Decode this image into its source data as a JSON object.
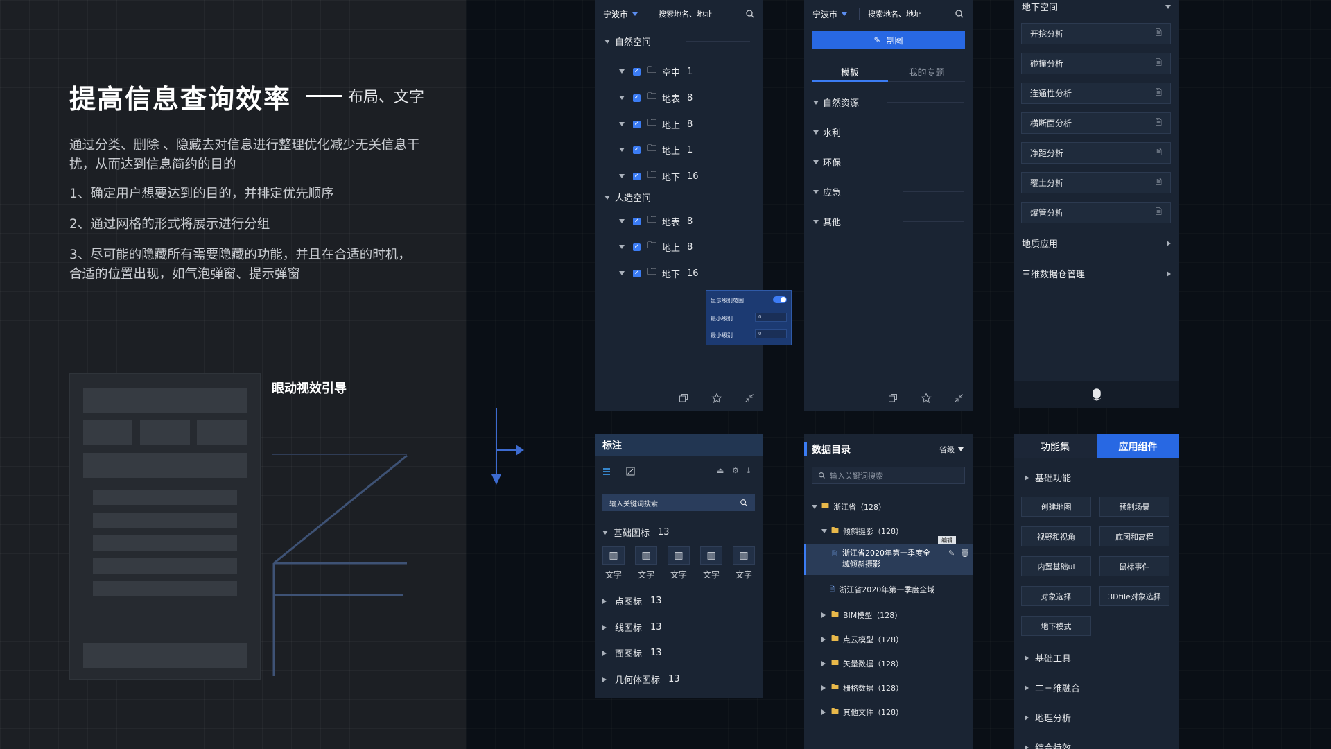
{
  "intro": {
    "title": "提高信息查询效率",
    "subtitle": "布局、文字",
    "p1": "通过分类、删除 、隐藏去对信息进行整理优化减少无关信息干扰，从而达到信息简约的目的",
    "p2": "1、确定用户想要达到的目的，并排定优先顺序",
    "p3": "2、通过网格的形式将展示进行分组",
    "p4": "3、尽可能的隐藏所有需要隐藏的功能，并且在合适的时机，合适的位置出现，如气泡弹窗、提示弹窗",
    "eye_label": "眼动视效引导"
  },
  "panel1": {
    "city": "宁波市",
    "search_placeholder": "搜索地名、地址",
    "group1": "自然空间",
    "group2": "人造空间",
    "items1": [
      {
        "label": "空中",
        "count": "1"
      },
      {
        "label": "地表",
        "count": "8"
      },
      {
        "label": "地上",
        "count": "8"
      },
      {
        "label": "地上",
        "count": "1"
      },
      {
        "label": "地下",
        "count": "16"
      }
    ],
    "items2": [
      {
        "label": "地表",
        "count": "8"
      },
      {
        "label": "地上",
        "count": "8"
      },
      {
        "label": "地下",
        "count": "16"
      }
    ],
    "popup": {
      "show_label": "显示级别范围",
      "min_label": "最小级别",
      "min_value": "0",
      "max_label": "最小级别",
      "max_value": "0"
    }
  },
  "panel2": {
    "city": "宁波市",
    "search_placeholder": "搜索地名、地址",
    "draw_button": "制图",
    "tab_template": "模板",
    "tab_mine": "我的专题",
    "categories": [
      "自然资源",
      "水利",
      "环保",
      "应急",
      "其他"
    ]
  },
  "panel3": {
    "header": "地下空间",
    "items": [
      "开挖分析",
      "碰撞分析",
      "连通性分析",
      "横断面分析",
      "净距分析",
      "覆土分析",
      "爆管分析"
    ],
    "sections": [
      "地质应用",
      "三维数据仓管理"
    ]
  },
  "panel4": {
    "title": "标注",
    "search_placeholder": "输入关键词搜索",
    "basic_group": "基础图标",
    "basic_count": "13",
    "icon_text": "文字",
    "groups": [
      {
        "label": "点图标",
        "count": "13"
      },
      {
        "label": "线图标",
        "count": "13"
      },
      {
        "label": "面图标",
        "count": "13"
      },
      {
        "label": "几何体图标",
        "count": "13"
      }
    ]
  },
  "panel5": {
    "title": "数据目录",
    "level": "省级",
    "search_placeholder": "输入关键词搜索",
    "root": "浙江省（128）",
    "sub": "倾斜摄影（128）",
    "selected_file": "浙江省2020年第一季度全域倾斜摄影",
    "edit_tip": "编辑",
    "file2": "浙江省2020年第一季度全域",
    "folders": [
      "BIM模型（128）",
      "点云模型（128）",
      "矢量数据（128）",
      "栅格数据（128）",
      "其他文件（128）"
    ]
  },
  "panel6": {
    "tab_func": "功能集",
    "tab_comp": "应用组件",
    "section1": "基础功能",
    "buttons": [
      "创建地图",
      "预制场景",
      "视野和视角",
      "底图和高程",
      "内置基础ui",
      "鼠标事件",
      "对象选择",
      "3Dtile对象选择",
      "地下模式"
    ],
    "sections": [
      "基础工具",
      "二三维融合",
      "地理分析",
      "综合特效"
    ]
  }
}
